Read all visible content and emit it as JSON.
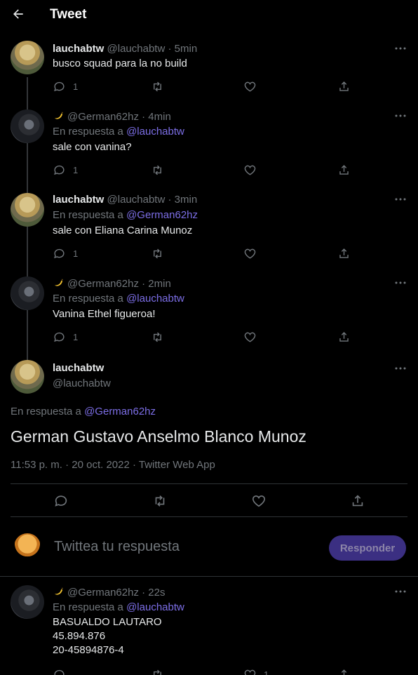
{
  "header": {
    "title": "Tweet"
  },
  "colors": {
    "background": "#000000",
    "text": "#e7e9ea",
    "muted": "#71767b",
    "link": "#7c6ee6",
    "button": "#3b2f82"
  },
  "replies": [
    {
      "name": "lauchabtw",
      "handle": "@lauchabtw",
      "time": "· 5min",
      "replying_prefix": "",
      "replying_to": "",
      "text": "busco squad para la no build",
      "reply_count": "1",
      "retweet_count": "",
      "like_count": ""
    },
    {
      "name": "",
      "handle": "@German62hz",
      "time": "· 4min",
      "replying_prefix": "En respuesta a",
      "replying_to": "@lauchabtw",
      "text": "sale con vanina?",
      "reply_count": "1",
      "retweet_count": "",
      "like_count": ""
    },
    {
      "name": "lauchabtw",
      "handle": "@lauchabtw",
      "time": "· 3min",
      "replying_prefix": "En respuesta a",
      "replying_to": "@German62hz",
      "text": "sale con Eliana Carina Munoz",
      "reply_count": "1",
      "retweet_count": "",
      "like_count": ""
    },
    {
      "name": "",
      "handle": "@German62hz",
      "time": "· 2min",
      "replying_prefix": "En respuesta a",
      "replying_to": "@lauchabtw",
      "text": "Vanina Ethel figueroa!",
      "reply_count": "1",
      "retweet_count": "",
      "like_count": ""
    }
  ],
  "main_tweet": {
    "name": "lauchabtw",
    "handle": "@lauchabtw",
    "replying_prefix": "En respuesta a",
    "replying_to": "@German62hz",
    "text": "German Gustavo Anselmo Blanco Munoz",
    "timestamp": "11:53 p. m. · 20 oct. 2022 · Twitter Web App"
  },
  "compose": {
    "placeholder": "Twittea tu respuesta",
    "button_label": "Responder"
  },
  "last_reply": {
    "handle": "@German62hz",
    "time": "· 22s",
    "replying_prefix": "En respuesta a",
    "replying_to": "@lauchabtw",
    "text_lines": [
      "BASUALDO LAUTARO",
      "45.894.876",
      "20-45894876-4"
    ],
    "like_count": "1"
  }
}
